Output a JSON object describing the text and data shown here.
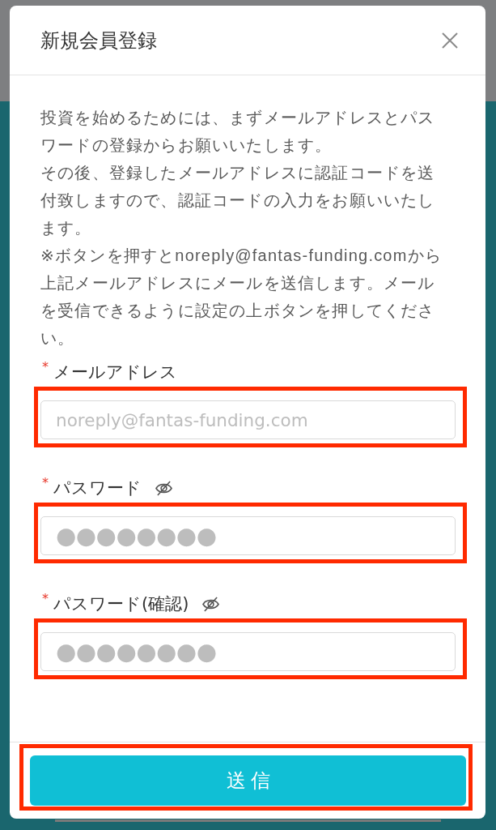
{
  "dialog": {
    "title": "新規会員登録"
  },
  "intro_paragraphs": [
    "投資を始めるためには、まずメールアドレスとパスワードの登録からお願いいたします。",
    "その後、登録したメールアドレスに認証コードを送付致しますので、認証コードの入力をお願いいたします。",
    "※ボタンを押すとnoreply@fantas-funding.comから上記メールアドレスにメールを送信します。メールを受信できるように設定の上ボタンを押してください。"
  ],
  "fields": [
    {
      "kind": "email",
      "required_mark": "*",
      "label": "メールアドレス",
      "placeholder": "noreply@fantas-funding.com",
      "highlighted": true
    },
    {
      "kind": "password",
      "required_mark": "*",
      "label": "パスワード",
      "placeholder": "●●●●●●●●",
      "highlighted": true
    },
    {
      "kind": "password",
      "required_mark": "*",
      "label": "パスワード(確認)",
      "placeholder": "●●●●●●●●",
      "highlighted": true
    }
  ],
  "submit_button": {
    "label": "送信",
    "highlighted": true
  }
}
